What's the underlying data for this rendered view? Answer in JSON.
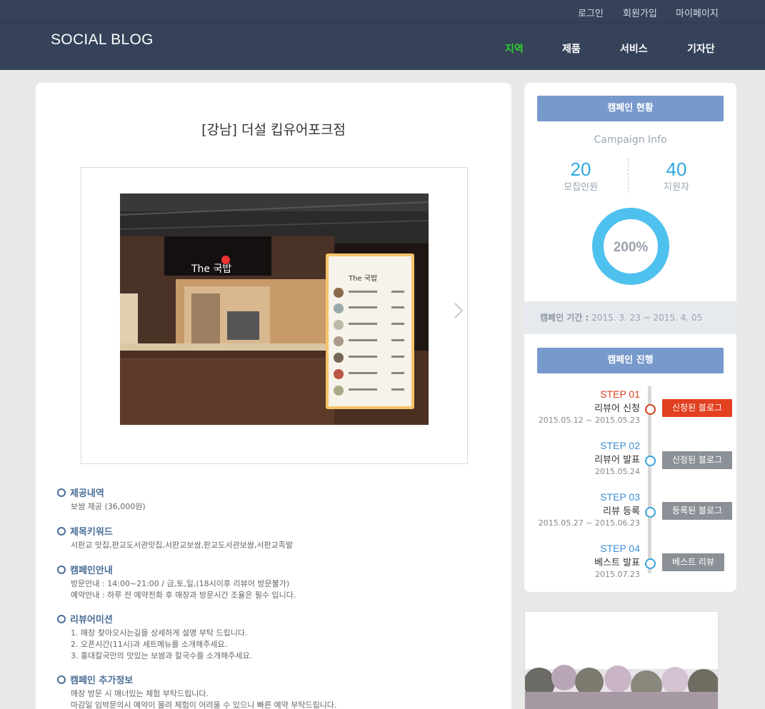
{
  "header": {
    "logo": "SOCIAL BLOG",
    "util_links": [
      "로그인",
      "회원가입",
      "마이페이지"
    ],
    "nav": [
      "지역",
      "제품",
      "서비스",
      "기자단"
    ],
    "active_nav": "지역",
    "colors": {
      "bar": "#354259",
      "active": "#2fd12f"
    }
  },
  "main": {
    "title": "[강남] 더설 킵유어포크점",
    "photo": {
      "alt": "restaurant counter photo",
      "sign_text": "The 국밥"
    },
    "next_icon": "chevron-right-icon",
    "sections": [
      {
        "heading": "제공내역",
        "lines": [
          "보쌈 제공 (36,000원)"
        ]
      },
      {
        "heading": "제목키워드",
        "lines": [
          "서판교 맛집,판교도서관맛집,서판교보쌈,판교도서관보쌈,서판교족발"
        ]
      },
      {
        "heading": "캠페인안내",
        "lines": [
          "방문안내 : 14:00~21:00 / 금,토,일,(18시이후 리뷰어 방문불가)",
          "예약안내 : 하루 전 예약전화 후 매장과 방문시간 조율은 필수 입니다."
        ]
      },
      {
        "heading": "리뷰어미션",
        "lines": [
          "1. 매장 찾아오시는길을 상세하게 설명 부탁 드립니다.",
          "2. 오픈시간(11시)과 세트메뉴를 소개해주세요.",
          "3. 홍대칼국만의 맛있는 보쌈과 칼국수를 소개해주세요."
        ]
      },
      {
        "heading": "캠페인 추가정보",
        "lines": [
          "매장 방문 시 매너있는 체험 부탁드립니다.",
          "마감일 임박문의시 예약이 몰려 체험이 어려울 수 있으니 빠른 예약 부탁드립니다."
        ]
      }
    ]
  },
  "campaign_status": {
    "button": "캠페인 현황",
    "subtitle": "Campaign Info",
    "recruit_count": "20",
    "recruit_label": "모집인원",
    "applicant_count": "40",
    "applicant_label": "지원자",
    "ratio_text": "200%",
    "ratio_fraction": 1.0,
    "period_label": "캠페인 기간 :",
    "period_value": "2015. 3. 23 ~ 2015. 4. 05",
    "colors": {
      "accent": "#2fa8e0",
      "button": "#7799cc",
      "donut": "#4fc1ef"
    }
  },
  "campaign_progress": {
    "button": "캠페인 진행",
    "steps": [
      {
        "no": "STEP 01",
        "name": "리뷰어 신청",
        "date": "2015.05.12 ~ 2015.05.23",
        "tag": "신청된 블로그",
        "active": true
      },
      {
        "no": "STEP 02",
        "name": "리뷰어 발표",
        "date": "2015.05.24",
        "tag": "신정된 블로그",
        "active": false
      },
      {
        "no": "STEP 03",
        "name": "리뷰 등록",
        "date": "2015.05.27 ~ 2015.06.23",
        "tag": "등록된 블로그",
        "active": false
      },
      {
        "no": "STEP 04",
        "name": "베스트 발표",
        "date": "2015.07.23",
        "tag": "베스트 리뷰",
        "active": false
      }
    ],
    "colors": {
      "active": "#e24020",
      "inactive": "#8b9097",
      "step": "#3d8fd4"
    }
  }
}
